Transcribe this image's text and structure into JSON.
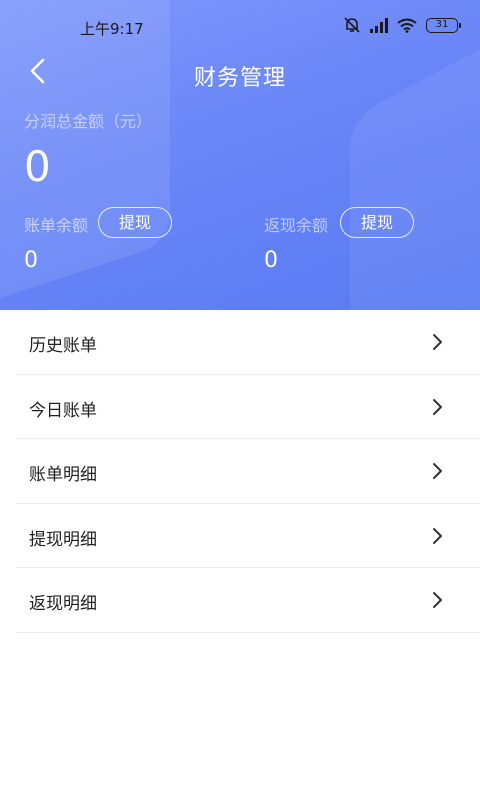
{
  "status_bar": {
    "time": "上午9:17",
    "battery": "31",
    "icons": [
      "alarm-off-icon",
      "signal-icon",
      "wifi-icon",
      "battery-icon"
    ]
  },
  "nav": {
    "title": "财务管理",
    "back_icon": "chevron-left-icon"
  },
  "summary": {
    "total_label": "分润总金额（元）",
    "total_value": "0",
    "account_balance": {
      "label": "账单余额",
      "button": "提现",
      "value": "0"
    },
    "cashback_balance": {
      "label": "返现余额",
      "button": "提现",
      "value": "0"
    }
  },
  "menu": {
    "items": [
      {
        "label": "历史账单"
      },
      {
        "label": "今日账单"
      },
      {
        "label": "账单明细"
      },
      {
        "label": "提现明细"
      },
      {
        "label": "返现明细"
      }
    ],
    "chevron_icon": "chevron-right-icon"
  },
  "colors": {
    "header_gradient_start": "#7e98fa",
    "header_gradient_end": "#587af3",
    "text_primary": "#222222",
    "divider": "#ececec"
  }
}
